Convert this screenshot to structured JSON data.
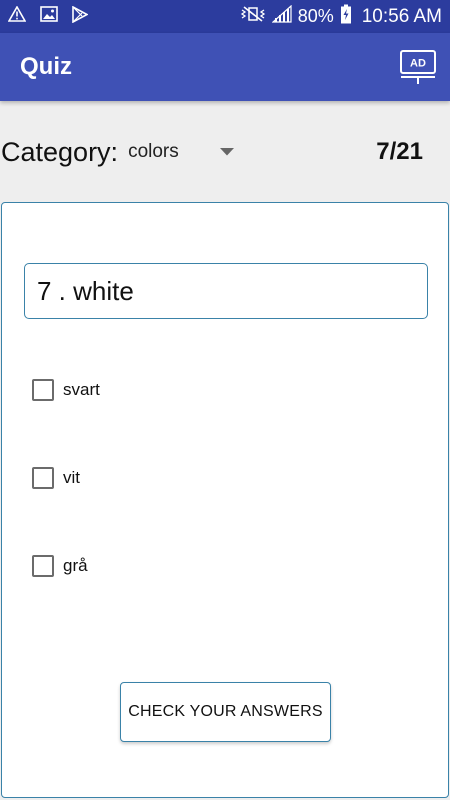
{
  "status_bar": {
    "icons_left": [
      "warning-icon",
      "image-icon",
      "play-store-icon"
    ],
    "battery": "80%",
    "time": "10:56 AM",
    "icons_right": [
      "vibrate-mute-icon",
      "signal-icon",
      "battery-charging-icon"
    ]
  },
  "app_bar": {
    "title": "Quiz",
    "ad_label": "AD"
  },
  "category": {
    "label": "Category:",
    "selected": "colors"
  },
  "progress": {
    "counter": "7/21"
  },
  "question": {
    "text": "7 . white"
  },
  "options": [
    {
      "label": "svart",
      "checked": false
    },
    {
      "label": "vit",
      "checked": false
    },
    {
      "label": "grå",
      "checked": false
    }
  ],
  "check_button": {
    "label": "CHECK YOUR ANSWERS"
  },
  "colors": {
    "status_bar": "#2c3c9e",
    "app_bar": "#3f51b5",
    "border_accent": "#3a82a8"
  }
}
